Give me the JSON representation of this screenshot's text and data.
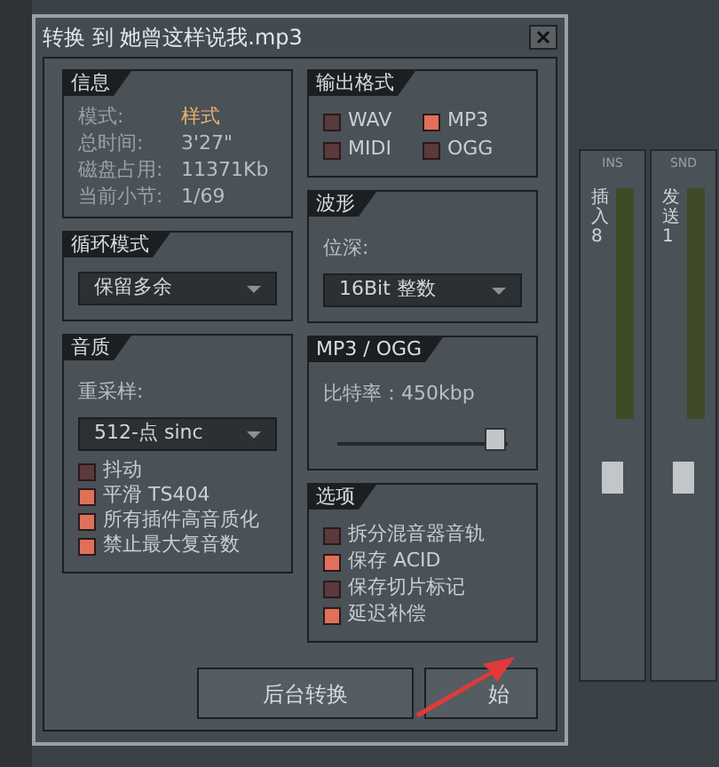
{
  "window": {
    "title": "转换 到 她曾这样说我.mp3"
  },
  "info": {
    "title": "信息",
    "rows": [
      {
        "label": "模式:",
        "value": "样式",
        "highlight": true
      },
      {
        "label": "总时间:",
        "value": "3'27\"",
        "highlight": false
      },
      {
        "label": "磁盘占用:",
        "value": "11371Kb",
        "highlight": false
      },
      {
        "label": "当前小节:",
        "value": "1/69",
        "highlight": false
      }
    ]
  },
  "loop_mode": {
    "title": "循环模式",
    "value": "保留多余"
  },
  "quality": {
    "title": "音质",
    "resample_label": "重采样:",
    "resample_value": "512-点 sinc",
    "options": [
      {
        "label": "抖动",
        "checked": false
      },
      {
        "label": "平滑 TS404",
        "checked": true
      },
      {
        "label": "所有插件高音质化",
        "checked": true
      },
      {
        "label": "禁止最大复音数",
        "checked": true
      }
    ]
  },
  "output_format": {
    "title": "输出格式",
    "formats": [
      {
        "label": "WAV",
        "checked": false
      },
      {
        "label": "MP3",
        "checked": true
      },
      {
        "label": "MIDI",
        "checked": false
      },
      {
        "label": "OGG",
        "checked": false
      }
    ]
  },
  "waveform": {
    "title": "波形",
    "depth_label": "位深:",
    "depth_value": "16Bit 整数"
  },
  "mp3_ogg": {
    "title": "MP3 / OGG",
    "bitrate": "比特率：450kbp",
    "level": 0.93
  },
  "options": {
    "title": "选项",
    "items": [
      {
        "label": "拆分混音器音轨",
        "checked": false
      },
      {
        "label": "保存 ACID",
        "checked": true
      },
      {
        "label": "保存切片标记",
        "checked": false
      },
      {
        "label": "延迟补偿",
        "checked": true
      }
    ]
  },
  "buttons": [
    "后台转换",
    "始"
  ],
  "mixer": [
    {
      "tag": "INS",
      "name": "插入 8"
    },
    {
      "tag": "SND",
      "name": "发送 1"
    }
  ]
}
